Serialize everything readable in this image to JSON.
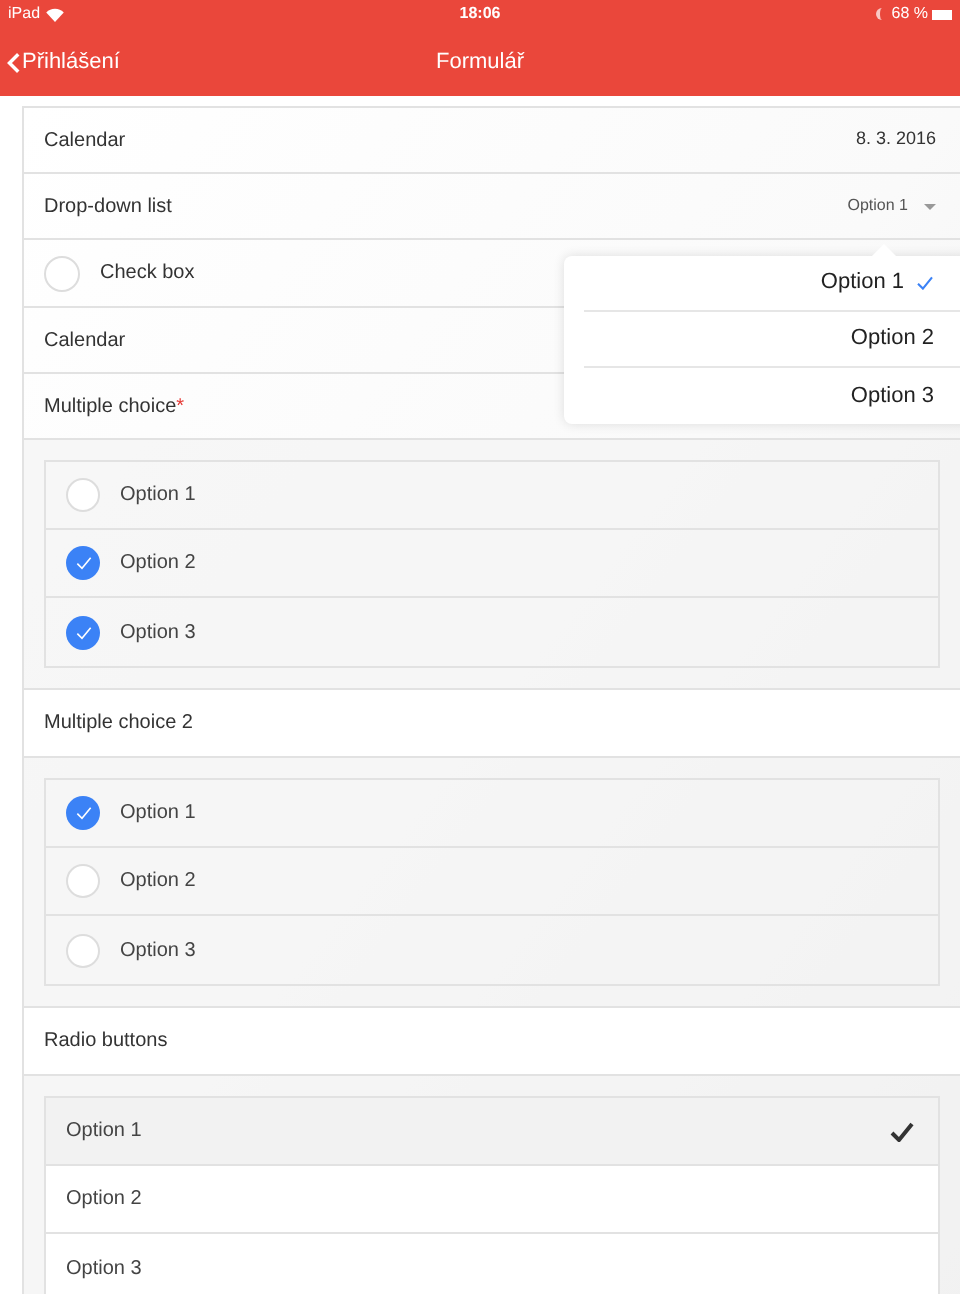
{
  "status_bar": {
    "device": "iPad",
    "time": "18:06",
    "battery": "68 %"
  },
  "nav_bar": {
    "back": "Přihlášení",
    "title": "Formulář"
  },
  "form": [
    {
      "kind": "value",
      "label": "Calendar",
      "value": "8. 3. 2016"
    },
    {
      "kind": "dropdown",
      "label": "Drop-down list",
      "value": "Option 1"
    },
    {
      "kind": "checkbox",
      "label": "Check box",
      "checked": false
    },
    {
      "kind": "value",
      "label": "Calendar"
    },
    {
      "kind": "header",
      "label": "Multiple choice",
      "required_mark": "*"
    },
    {
      "kind": "choices",
      "options": [
        {
          "label": "Option 1",
          "checked": false
        },
        {
          "label": "Option 2",
          "checked": true
        },
        {
          "label": "Option 3",
          "checked": true
        }
      ]
    },
    {
      "kind": "header",
      "label": "Multiple choice 2"
    },
    {
      "kind": "choices",
      "options": [
        {
          "label": "Option 1",
          "checked": true
        },
        {
          "label": "Option 2",
          "checked": false
        },
        {
          "label": "Option 3",
          "checked": false
        }
      ]
    },
    {
      "kind": "header",
      "label": "Radio buttons"
    },
    {
      "kind": "radio",
      "options": [
        {
          "label": "Option 1",
          "selected": true
        },
        {
          "label": "Option 2",
          "selected": false
        },
        {
          "label": "Option 3",
          "selected": false
        }
      ]
    }
  ],
  "dropdown_popover": {
    "options": [
      {
        "label": "Option 1",
        "selected": true
      },
      {
        "label": "Option 2",
        "selected": false
      },
      {
        "label": "Option 3",
        "selected": false
      }
    ]
  }
}
